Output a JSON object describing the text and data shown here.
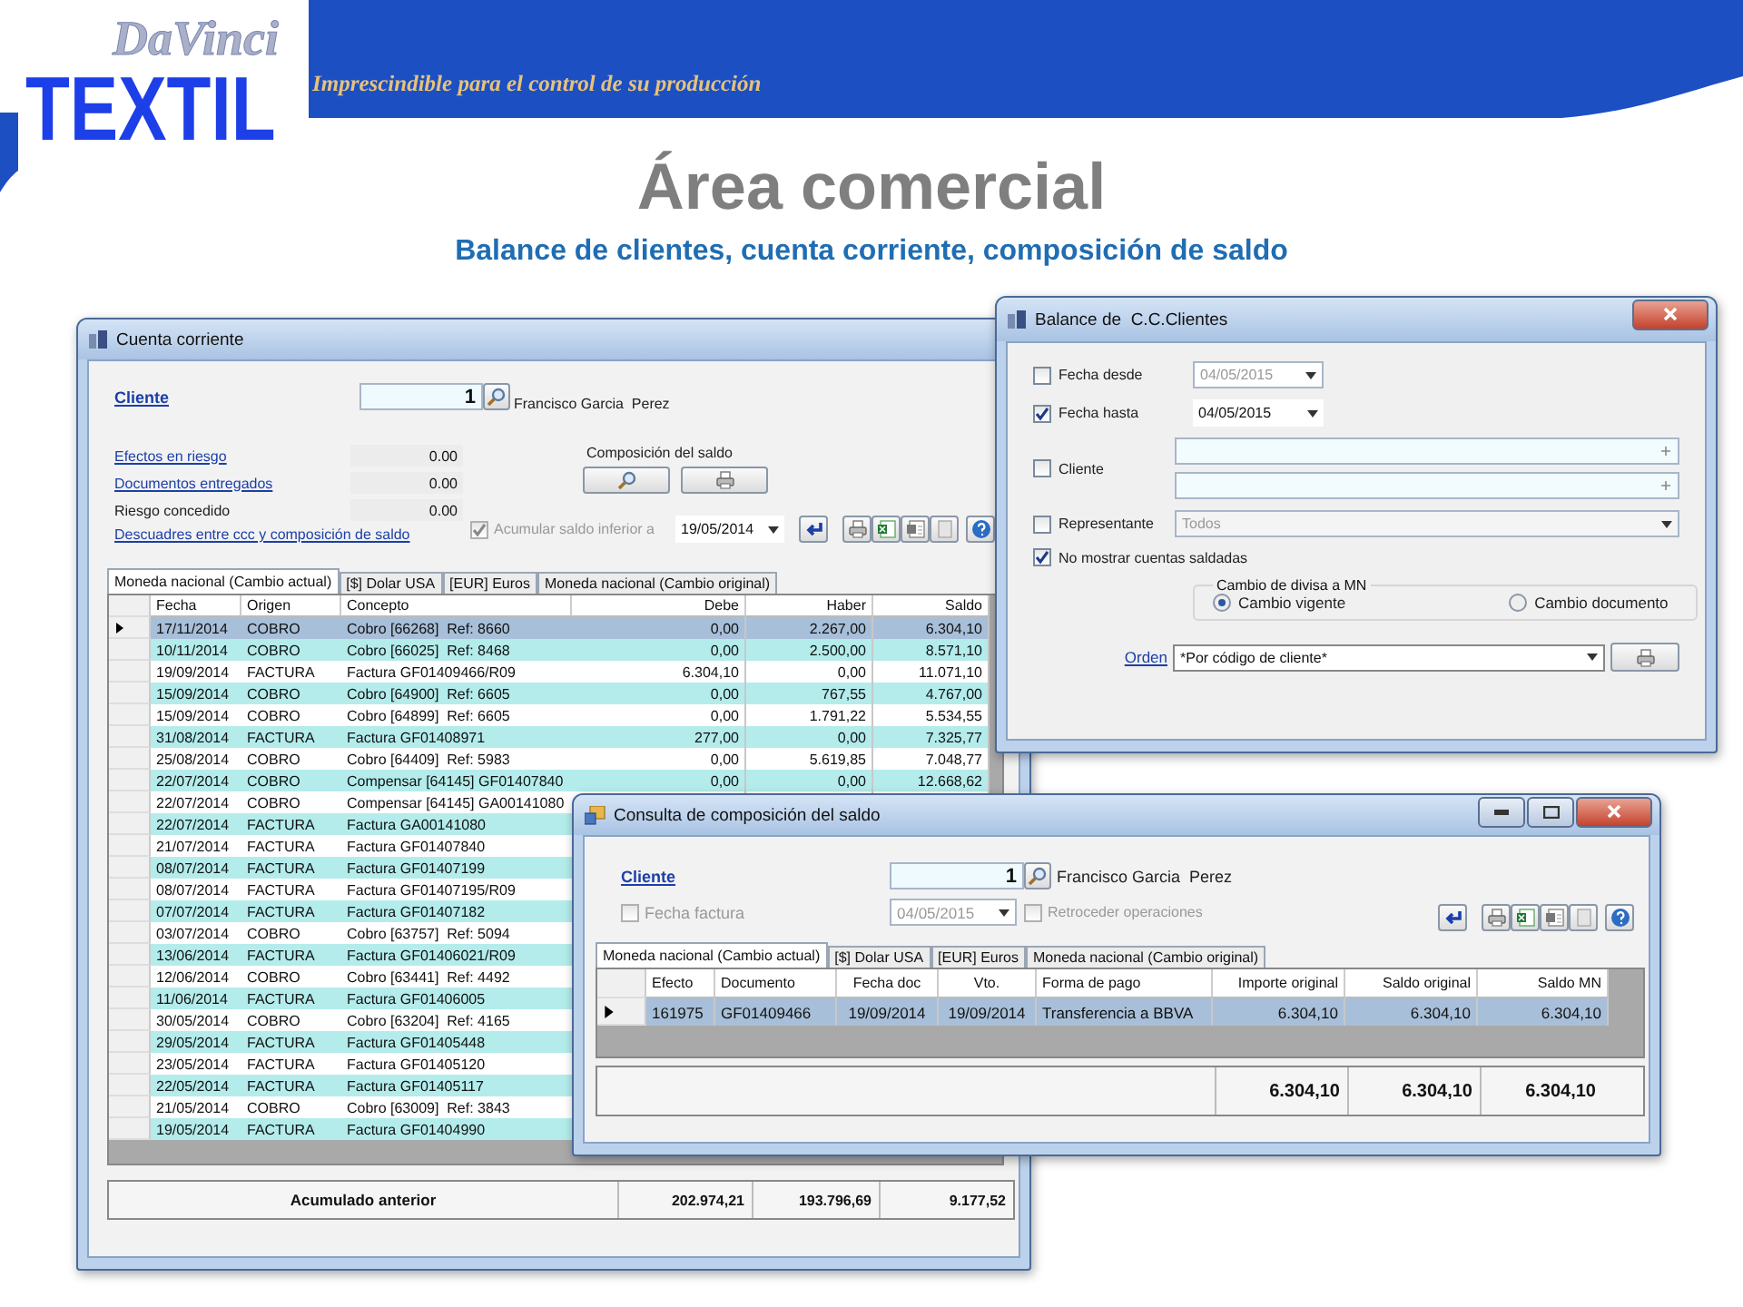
{
  "header": {
    "logo_top": "DaVinci",
    "logo_main": "TEXTIL",
    "tagline": "Imprescindible para el control de su producción"
  },
  "title": "Área comercial",
  "subtitle": "Balance de clientes, cuenta corriente, composición de saldo",
  "cuenta_corriente": {
    "title": "Cuenta corriente",
    "cliente_label": "Cliente",
    "cliente_value": "1",
    "cliente_name": "Francisco Garcia  Perez",
    "summary": [
      {
        "label": "Efectos en riesgo",
        "kind": "link",
        "value": "0.00"
      },
      {
        "label": "Documentos entregados",
        "kind": "link",
        "value": "0.00"
      },
      {
        "label": "Riesgo concedido",
        "kind": "plain",
        "value": "0.00"
      }
    ],
    "descuadres_link": "Descuadres entre ccc y composición de saldo",
    "composicion_label": "Composición del saldo",
    "acumular": {
      "label": "Acumular saldo inferior a",
      "checked": true
    },
    "acumular_date": "19/05/2014",
    "tabs": [
      {
        "label": "Moneda nacional (Cambio actual)",
        "selected": true
      },
      {
        "label": "[$] Dolar USA",
        "selected": false
      },
      {
        "label": "[EUR] Euros",
        "selected": false
      },
      {
        "label": "Moneda nacional (Cambio original)",
        "selected": false
      }
    ],
    "columns": [
      "Fecha",
      "Origen",
      "Concepto",
      "Debe",
      "Haber",
      "Saldo"
    ],
    "rows": [
      {
        "fecha": "17/11/2014",
        "origen": "COBRO",
        "concepto": "Cobro [66268]  Ref: 8660",
        "debe": "0,00",
        "haber": "2.267,00",
        "saldo": "6.304,10",
        "selected": true
      },
      {
        "fecha": "10/11/2014",
        "origen": "COBRO",
        "concepto": "Cobro [66025]  Ref: 8468",
        "debe": "0,00",
        "haber": "2.500,00",
        "saldo": "8.571,10",
        "selected": false
      },
      {
        "fecha": "19/09/2014",
        "origen": "FACTURA",
        "concepto": "Factura GF01409466/R09",
        "debe": "6.304,10",
        "haber": "0,00",
        "saldo": "11.071,10",
        "selected": false
      },
      {
        "fecha": "15/09/2014",
        "origen": "COBRO",
        "concepto": "Cobro [64900]  Ref: 6605",
        "debe": "0,00",
        "haber": "767,55",
        "saldo": "4.767,00",
        "selected": false
      },
      {
        "fecha": "15/09/2014",
        "origen": "COBRO",
        "concepto": "Cobro [64899]  Ref: 6605",
        "debe": "0,00",
        "haber": "1.791,22",
        "saldo": "5.534,55",
        "selected": false
      },
      {
        "fecha": "31/08/2014",
        "origen": "FACTURA",
        "concepto": "Factura GF01408971",
        "debe": "277,00",
        "haber": "0,00",
        "saldo": "7.325,77",
        "selected": false
      },
      {
        "fecha": "25/08/2014",
        "origen": "COBRO",
        "concepto": "Cobro [64409]  Ref: 5983",
        "debe": "0,00",
        "haber": "5.619,85",
        "saldo": "7.048,77",
        "selected": false
      },
      {
        "fecha": "22/07/2014",
        "origen": "COBRO",
        "concepto": "Compensar [64145] GF01407840",
        "debe": "0,00",
        "haber": "0,00",
        "saldo": "12.668,62",
        "selected": false
      },
      {
        "fecha": "22/07/2014",
        "origen": "COBRO",
        "concepto": "Compensar [64145] GA00141080",
        "selected": false
      },
      {
        "fecha": "22/07/2014",
        "origen": "FACTURA",
        "concepto": "Factura GA00141080",
        "selected": false
      },
      {
        "fecha": "21/07/2014",
        "origen": "FACTURA",
        "concepto": "Factura GF01407840",
        "selected": false
      },
      {
        "fecha": "08/07/2014",
        "origen": "FACTURA",
        "concepto": "Factura GF01407199",
        "selected": false
      },
      {
        "fecha": "08/07/2014",
        "origen": "FACTURA",
        "concepto": "Factura GF01407195/R09",
        "selected": false
      },
      {
        "fecha": "07/07/2014",
        "origen": "FACTURA",
        "concepto": "Factura GF01407182",
        "selected": false
      },
      {
        "fecha": "03/07/2014",
        "origen": "COBRO",
        "concepto": "Cobro [63757]  Ref: 5094",
        "selected": false
      },
      {
        "fecha": "13/06/2014",
        "origen": "FACTURA",
        "concepto": "Factura GF01406021/R09",
        "selected": false
      },
      {
        "fecha": "12/06/2014",
        "origen": "COBRO",
        "concepto": "Cobro [63441]  Ref: 4492",
        "selected": false
      },
      {
        "fecha": "11/06/2014",
        "origen": "FACTURA",
        "concepto": "Factura GF01406005",
        "selected": false
      },
      {
        "fecha": "30/05/2014",
        "origen": "COBRO",
        "concepto": "Cobro [63204]  Ref: 4165",
        "selected": false
      },
      {
        "fecha": "29/05/2014",
        "origen": "FACTURA",
        "concepto": "Factura GF01405448",
        "selected": false
      },
      {
        "fecha": "23/05/2014",
        "origen": "FACTURA",
        "concepto": "Factura GF01405120",
        "selected": false
      },
      {
        "fecha": "22/05/2014",
        "origen": "FACTURA",
        "concepto": "Factura GF01405117",
        "selected": false
      },
      {
        "fecha": "21/05/2014",
        "origen": "COBRO",
        "concepto": "Cobro [63009]  Ref: 3843",
        "selected": false
      },
      {
        "fecha": "19/05/2014",
        "origen": "FACTURA",
        "concepto": "Factura GF01404990",
        "selected": false
      }
    ],
    "totals": {
      "label": "Acumulado anterior",
      "debe": "202.974,21",
      "haber": "193.796,69",
      "saldo": "9.177,52"
    }
  },
  "balance": {
    "title": "Balance de  C.C.Clientes",
    "fecha_desde": {
      "label": "Fecha desde",
      "checked": false,
      "value": "04/05/2015"
    },
    "fecha_hasta": {
      "label": "Fecha hasta",
      "checked": true,
      "value": "04/05/2015"
    },
    "cliente": {
      "label": "Cliente",
      "checked": false
    },
    "representante": {
      "label": "Representante",
      "checked": false,
      "value": "Todos"
    },
    "no_mostrar": {
      "label": "No mostrar cuentas saldadas",
      "checked": true
    },
    "cambio": {
      "legend": "Cambio de divisa a MN",
      "options": [
        {
          "label": "Cambio vigente",
          "selected": true
        },
        {
          "label": "Cambio documento",
          "selected": false
        }
      ]
    },
    "orden": {
      "label": "Orden",
      "value": "*Por código de cliente*"
    }
  },
  "consulta": {
    "title": "Consulta de composición del saldo",
    "cliente_label": "Cliente",
    "cliente_value": "1",
    "cliente_name": "Francisco Garcia  Perez",
    "fecha_factura": {
      "label": "Fecha factura",
      "checked": false
    },
    "fecha_value": "04/05/2015",
    "retroceder": {
      "label": "Retroceder operaciones",
      "checked": false
    },
    "tabs": [
      {
        "label": "Moneda nacional (Cambio actual)",
        "selected": true
      },
      {
        "label": "[$] Dolar USA",
        "selected": false
      },
      {
        "label": "[EUR] Euros",
        "selected": false
      },
      {
        "label": "Moneda nacional (Cambio original)",
        "selected": false
      }
    ],
    "columns": [
      "Efecto",
      "Documento",
      "Fecha doc",
      "Vto.",
      "Forma de pago",
      "Importe original",
      "Saldo original",
      "Saldo MN"
    ],
    "rows": [
      {
        "cells": [
          "161975",
          "GF01409466",
          "19/09/2014",
          "19/09/2014",
          "Transferencia a BBVA",
          "6.304,10",
          "6.304,10",
          "6.304,10"
        ],
        "selected": true
      }
    ],
    "totals": [
      "6.304,10",
      "6.304,10",
      "6.304,10"
    ]
  }
}
